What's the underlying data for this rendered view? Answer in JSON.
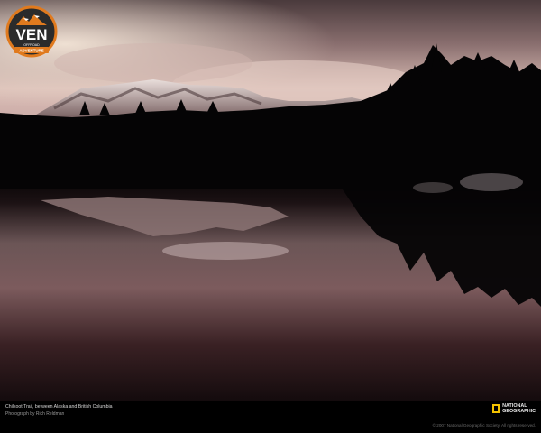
{
  "logo": {
    "main_text": "VEN",
    "top_text": "OFFROAD",
    "ribbon_text": "ADVENTURE"
  },
  "caption": {
    "title": "Chilkoot Trail, between Alaska and British Columbia",
    "credit": "Photograph by Rich Reldman",
    "copyright": "© 2007 National Geographic Society. All rights reserved."
  },
  "publisher": {
    "line1": "NATIONAL",
    "line2": "GEOGRAPHIC",
    "accent_color": "#f2c200"
  },
  "colors": {
    "sky_top": "#3a2e30",
    "sky_glow": "#e8c8c0",
    "water": "#2a1a1e",
    "logo_orange": "#e07a1e",
    "logo_dark": "#2b2b2b"
  }
}
